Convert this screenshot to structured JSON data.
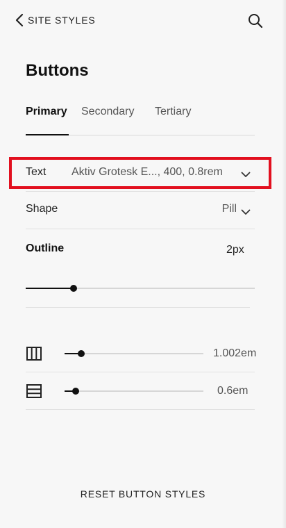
{
  "header": {
    "back_label": "SITE STYLES",
    "back_icon": "chevron-left-icon",
    "search_icon": "search-icon"
  },
  "page": {
    "title": "Buttons"
  },
  "tabs": [
    {
      "label": "Primary",
      "active": true
    },
    {
      "label": "Secondary",
      "active": false
    },
    {
      "label": "Tertiary",
      "active": false
    }
  ],
  "rows": {
    "text": {
      "label": "Text",
      "value": "Aktiv Grotesk E..., 400, 0.8rem"
    },
    "shape": {
      "label": "Shape",
      "value": "Pill"
    }
  },
  "outline": {
    "label": "Outline",
    "value": "2px",
    "slider_fraction": 0.21
  },
  "padding": {
    "horizontal": {
      "icon": "columns-icon",
      "value": "1.002em",
      "slider_fraction": 0.12
    },
    "vertical": {
      "icon": "rows-icon",
      "value": "0.6em",
      "slider_fraction": 0.08
    }
  },
  "footer": {
    "reset_label": "RESET BUTTON STYLES"
  },
  "colors": {
    "highlight": "#e2101f",
    "text": "#1f1f1f",
    "muted": "#555555",
    "background": "#f7f7f7"
  }
}
